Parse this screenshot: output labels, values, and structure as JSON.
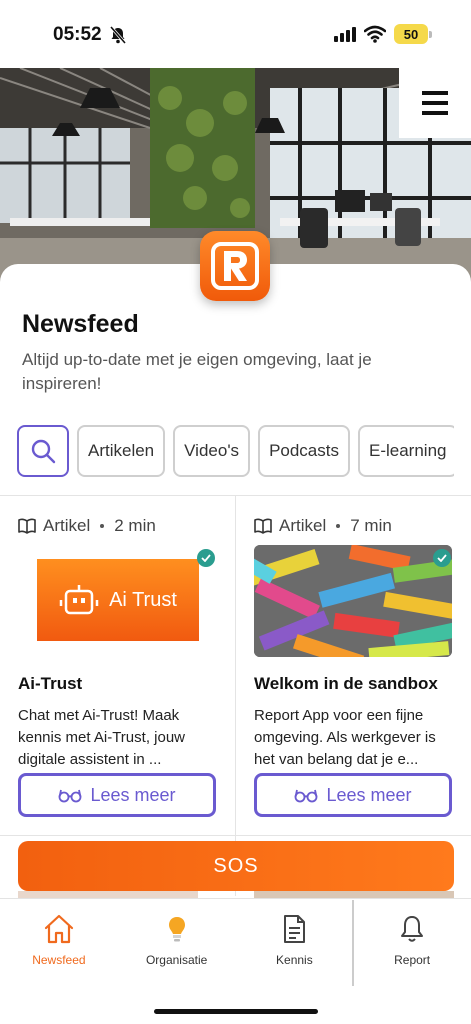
{
  "status_bar": {
    "time": "05:52",
    "battery": "50"
  },
  "header": {
    "title": "Newsfeed",
    "subtitle": "Altijd up-to-date met je eigen omgeving, laat je inspireren!"
  },
  "filters": {
    "items": [
      {
        "label": "Artikelen"
      },
      {
        "label": "Video's"
      },
      {
        "label": "Podcasts"
      },
      {
        "label": "E-learning"
      }
    ]
  },
  "cards": [
    {
      "type": "Artikel",
      "duration": "2 min",
      "title": "Ai-Trust",
      "description": "Chat met Ai-Trust! Maak kennis met Ai-Trust, jouw digitale assistent in ...",
      "button": "Lees meer",
      "thumb_text": "Ai Trust"
    },
    {
      "type": "Artikel",
      "duration": "7 min",
      "title": "Welkom in de sandbox",
      "description": "Report App voor een fijne omgeving. Als werkgever is het van belang dat je e...",
      "button": "Lees meer"
    }
  ],
  "sos": {
    "label": "SOS"
  },
  "nav": {
    "items": [
      {
        "label": "Newsfeed",
        "icon": "home-icon",
        "active": true
      },
      {
        "label": "Organisatie",
        "icon": "lightbulb-icon",
        "active": false
      },
      {
        "label": "Kennis",
        "icon": "document-icon",
        "active": false
      },
      {
        "label": "Report",
        "icon": "bell-icon",
        "active": false
      }
    ]
  },
  "colors": {
    "accent": "#f06a1e",
    "primary": "#6a5ad0",
    "check": "#2a9d8f"
  }
}
